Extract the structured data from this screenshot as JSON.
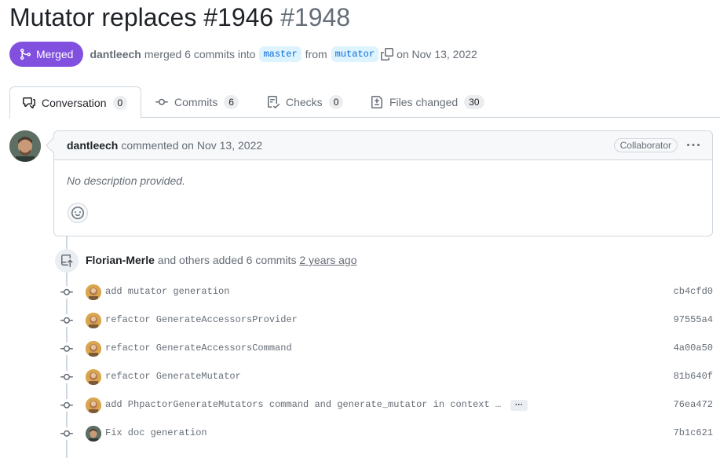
{
  "pr": {
    "title": "Mutator replaces",
    "number": "#1946",
    "number2": "#1948"
  },
  "meta": {
    "status": "Merged",
    "author": "dantleech",
    "merged_text": "merged 6 commits into",
    "base_branch": "master",
    "from_text": "from",
    "head_branch": "mutator",
    "date_text": "on Nov 13, 2022"
  },
  "tabs": [
    {
      "label": "Conversation",
      "count": "0",
      "icon": "comment-discussion-icon"
    },
    {
      "label": "Commits",
      "count": "6",
      "icon": "git-commit-icon"
    },
    {
      "label": "Checks",
      "count": "0",
      "icon": "checklist-icon"
    },
    {
      "label": "Files changed",
      "count": "30",
      "icon": "file-diff-icon"
    }
  ],
  "comment": {
    "author": "dantleech",
    "action": "commented on Nov 13, 2022",
    "role": "Collaborator",
    "body": "No description provided."
  },
  "commit_event": {
    "author": "Florian-Merle",
    "text": "and others added 6 commits",
    "when": "2 years ago"
  },
  "commits": [
    {
      "message": "add mutator generation",
      "sha": "cb4cfd0",
      "avatar": "avatar-florian"
    },
    {
      "message": "refactor GenerateAccessorsProvider",
      "sha": "97555a4",
      "avatar": "avatar-florian"
    },
    {
      "message": "refactor GenerateAccessorsCommand",
      "sha": "4a00a50",
      "avatar": "avatar-florian"
    },
    {
      "message": "refactor GenerateMutator",
      "sha": "81b640f",
      "avatar": "avatar-florian"
    },
    {
      "message": "add PhpactorGenerateMutators command and generate_mutator in context …",
      "sha": "76ea472",
      "avatar": "avatar-florian",
      "expandable": true,
      "expand_label": "···"
    },
    {
      "message": "Fix doc generation",
      "sha": "7b1c621",
      "avatar": "avatar-dantleech"
    }
  ],
  "colors": {
    "merged": "#8250df",
    "branch_bg": "#ddf4ff",
    "branch_fg": "#0969da",
    "muted": "#656d76",
    "border": "#d0d7de"
  }
}
